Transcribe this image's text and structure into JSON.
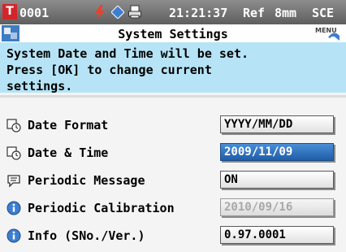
{
  "status": {
    "t_icon": "T",
    "measurement_number": "0001",
    "bolt_icon": "lightning-icon",
    "diamond_icon": "diamond-icon",
    "printer_icon": "printer-icon",
    "time": "21:21:37",
    "ref": "Ref",
    "aperture": "8mm",
    "mode": "SCE",
    "colors": {
      "bar": "#6e6e6e",
      "t_badge": "#d2262b",
      "bolt": "#e8422c",
      "diamond": "#3d7ed0"
    }
  },
  "titlebar": {
    "title": "System Settings",
    "menu_label": "MENU"
  },
  "message": {
    "lines": [
      "System Date and Time will be set.",
      "Press [OK] to change current",
      "settings."
    ],
    "color": "#b6e4f6"
  },
  "settings": [
    {
      "label": "Date Format",
      "value": "YYYY/MM/DD",
      "icon": "clock-settings-icon",
      "state": "normal"
    },
    {
      "label": "Date & Time",
      "value": "2009/11/09",
      "icon": "clock-settings-icon",
      "state": "selected"
    },
    {
      "label": "Periodic Message",
      "value": "ON",
      "icon": "speech-bubble-icon",
      "state": "normal"
    },
    {
      "label": "Periodic Calibration",
      "value": "2010/09/16",
      "icon": "info-icon",
      "state": "disabled"
    },
    {
      "label": "Info (SNo./Ver.)",
      "value": "0.97.0001",
      "icon": "info-icon",
      "state": "normal"
    }
  ]
}
